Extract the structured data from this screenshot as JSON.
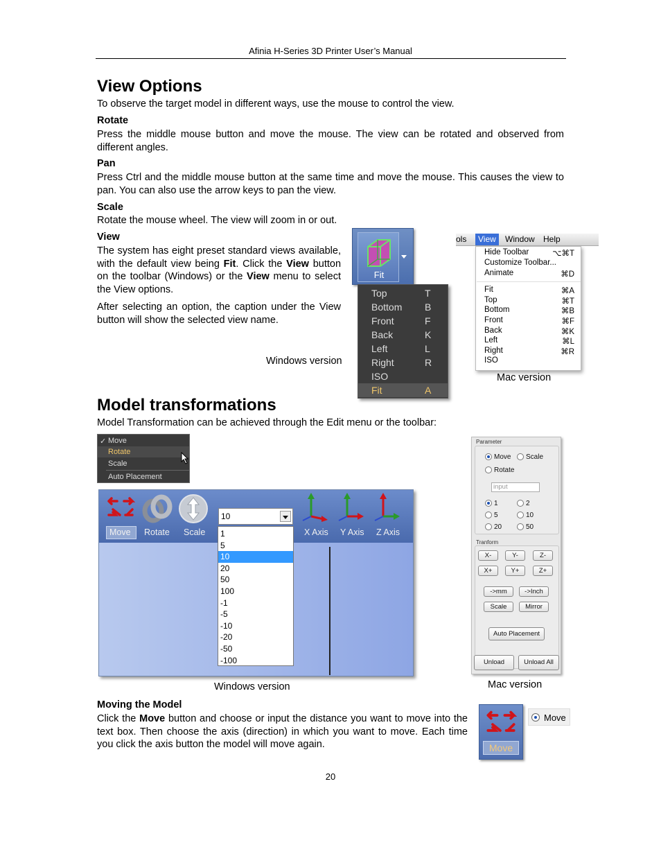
{
  "header": {
    "title": "Afinia H-Series 3D Printer User’s Manual"
  },
  "view_options": {
    "heading": "View Options",
    "intro": "To observe the target model in different ways, use the mouse to control the view.",
    "rotate": {
      "title": "Rotate",
      "text": "Press the middle mouse button and move the mouse.   The view can be rotated and observed from different angles."
    },
    "pan": {
      "title": "Pan",
      "text": "Press Ctrl and the middle mouse button at the same time and move the mouse.   This causes the view to pan.   You can also use the arrow keys to pan the view."
    },
    "scale": {
      "title": "Scale",
      "text": "Rotate the mouse wheel.   The view will zoom in or out."
    },
    "view": {
      "title": "View",
      "text1_a": "The system has eight preset standard views available, with the default view being ",
      "text1_b": "Fit",
      "text1_c": ".  Click the ",
      "text1_d": "View",
      "text1_e": " button on the toolbar (Windows) or the ",
      "text1_f": "View",
      "text1_g": " menu to select the View options.",
      "text2": "After selecting an option, the caption under the View button will show the selected view name."
    },
    "windows_caption": "Windows version",
    "mac_caption": "Mac version",
    "windows_view_button": {
      "label": "Fit"
    },
    "windows_view_menu": [
      {
        "label": "Top",
        "key": "T"
      },
      {
        "label": "Bottom",
        "key": "B"
      },
      {
        "label": "Front",
        "key": "F"
      },
      {
        "label": "Back",
        "key": "K"
      },
      {
        "label": "Left",
        "key": "L"
      },
      {
        "label": "Right",
        "key": "R"
      },
      {
        "label": "ISO",
        "key": ""
      },
      {
        "label": "Fit",
        "key": "A",
        "selected": true
      }
    ],
    "mac_menubar": {
      "items": [
        "ols",
        "View",
        "Window",
        "Help"
      ],
      "active": "View"
    },
    "mac_view_menu": {
      "group1": [
        {
          "label": "Hide Toolbar",
          "key": "⌥⌘T"
        },
        {
          "label": "Customize Toolbar...",
          "key": ""
        },
        {
          "label": "Animate",
          "key": "⌘D"
        }
      ],
      "group2": [
        {
          "label": "Fit",
          "key": "⌘A"
        },
        {
          "label": "Top",
          "key": "⌘T"
        },
        {
          "label": "Bottom",
          "key": "⌘B"
        },
        {
          "label": "Front",
          "key": "⌘F"
        },
        {
          "label": "Back",
          "key": "⌘K"
        },
        {
          "label": "Left",
          "key": "⌘L"
        },
        {
          "label": "Right",
          "key": "⌘R"
        },
        {
          "label": "ISO",
          "key": ""
        }
      ]
    }
  },
  "model_transformations": {
    "heading": "Model transformations",
    "intro": "Model Transformation can be achieved through the Edit menu or the toolbar:",
    "edit_menu": [
      {
        "label": "Move",
        "checked": true
      },
      {
        "label": "Rotate",
        "highlighted": true
      },
      {
        "label": "Scale"
      },
      {
        "label": "Auto Placement"
      }
    ],
    "toolbar": {
      "buttons": [
        "Move",
        "Rotate",
        "Scale",
        "X Axis",
        "Y Axis",
        "Z Axis"
      ],
      "distance_value": "10",
      "distance_options": [
        "1",
        "5",
        "10",
        "20",
        "50",
        "100",
        "-1",
        "-5",
        "-10",
        "-20",
        "-50",
        "-100"
      ],
      "distance_selected": "10"
    },
    "mac_panel": {
      "parameter_label": "Parameter",
      "modes": [
        {
          "label": "Move",
          "checked": true
        },
        {
          "label": "Scale"
        },
        {
          "label": "Rotate"
        }
      ],
      "input_placeholder": "input",
      "steps": [
        {
          "label": "1",
          "checked": true
        },
        {
          "label": "2"
        },
        {
          "label": "5"
        },
        {
          "label": "10"
        },
        {
          "label": "20"
        },
        {
          "label": "50"
        }
      ],
      "transform_label": "Tranform",
      "axis_buttons": [
        "X-",
        "Y-",
        "Z-",
        "X+",
        "Y+",
        "Z+"
      ],
      "unit_buttons": [
        "->mm",
        "->Inch"
      ],
      "action_buttons": [
        "Scale",
        "Mirror"
      ],
      "auto_placement": "Auto Placement",
      "unload": "Unload",
      "unload_all": "Unload All"
    },
    "windows_caption": "Windows version",
    "mac_caption": "Mac version",
    "moving": {
      "title": "Moving the Model",
      "text_a": "Click the ",
      "text_b": "Move",
      "text_c": " button and choose or input the distance you want to move into the text box.   Then choose the axis (direction) in which you want to move. Each time you click the axis button the model will move again.",
      "icon_label": "Move",
      "mac_radio_label": "Move"
    }
  },
  "page_number": "20"
}
